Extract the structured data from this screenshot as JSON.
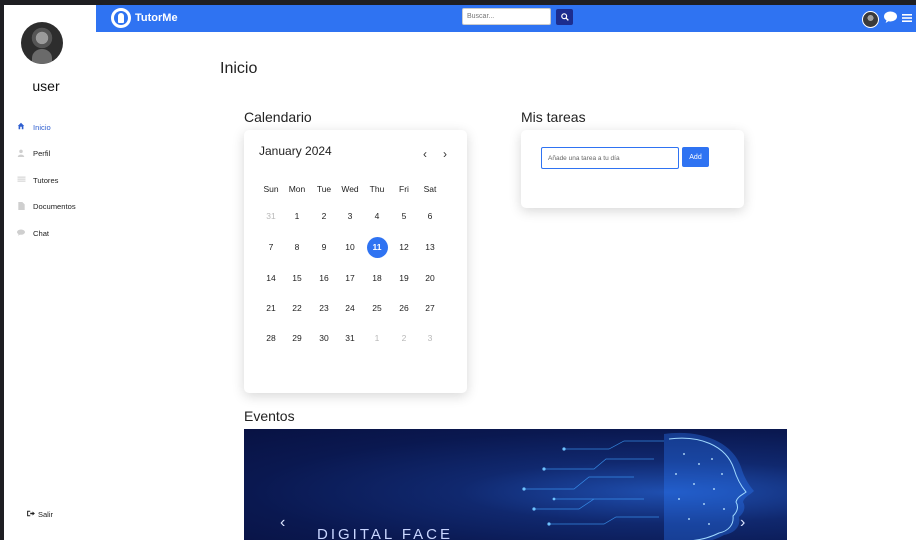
{
  "sidebar": {
    "username": "user",
    "items": [
      {
        "label": "Inicio",
        "icon": "home-icon"
      },
      {
        "label": "Perfil",
        "icon": "user-icon"
      },
      {
        "label": "Tutores",
        "icon": "list-icon"
      },
      {
        "label": "Documentos",
        "icon": "document-icon"
      },
      {
        "label": "Chat",
        "icon": "chat-icon"
      }
    ],
    "logout_label": "Salir",
    "active_color": "#2f5fd0"
  },
  "topbar": {
    "brand": "TutorMe",
    "search_placeholder": "Buscar...",
    "bg_color": "#2f73f2"
  },
  "page": {
    "title": "Inicio"
  },
  "calendar": {
    "section_title": "Calendario",
    "month": "January 2024",
    "prev_symbol": "‹",
    "next_symbol": "›",
    "weekdays": [
      "Sun",
      "Mon",
      "Tue",
      "Wed",
      "Thu",
      "Fri",
      "Sat"
    ],
    "weeks": [
      [
        "31",
        "1",
        "2",
        "3",
        "4",
        "5",
        "6"
      ],
      [
        "7",
        "8",
        "9",
        "10",
        "11",
        "12",
        "13"
      ],
      [
        "14",
        "15",
        "16",
        "17",
        "18",
        "19",
        "20"
      ],
      [
        "21",
        "22",
        "23",
        "24",
        "25",
        "26",
        "27"
      ],
      [
        "28",
        "29",
        "30",
        "31",
        "1",
        "2",
        "3"
      ]
    ],
    "selected_day": "11"
  },
  "tasks": {
    "section_title": "Mis tareas",
    "input_placeholder": "Añade una tarea a tu día",
    "add_label": "Add"
  },
  "events": {
    "section_title": "Eventos",
    "banner_caption": "DIGITAL FACE",
    "prev_symbol": "‹",
    "next_symbol": "›"
  }
}
